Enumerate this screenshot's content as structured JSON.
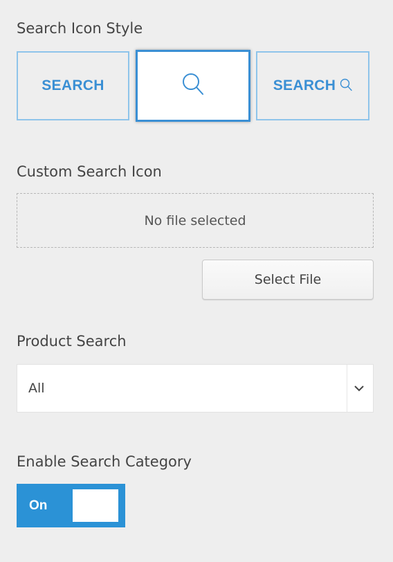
{
  "search_icon_style": {
    "label": "Search Icon Style",
    "options": [
      {
        "text": "SEARCH",
        "selected": false,
        "kind": "text-only"
      },
      {
        "text": "",
        "selected": true,
        "kind": "icon-only",
        "icon": "magnifier-icon"
      },
      {
        "text": "SEARCH",
        "selected": false,
        "kind": "text-and-icon",
        "icon": "magnifier-icon"
      }
    ],
    "accent_color": "#3a8fd4"
  },
  "custom_search_icon": {
    "label": "Custom Search Icon",
    "file_status": "No file selected",
    "select_button_label": "Select File"
  },
  "product_search": {
    "label": "Product Search",
    "selected_value": "All",
    "arrow_icon": "chevron-down-icon"
  },
  "enable_search_category": {
    "label": "Enable Search Category",
    "toggle_label": "On",
    "enabled": true,
    "toggle_color": "#2b92d6"
  }
}
